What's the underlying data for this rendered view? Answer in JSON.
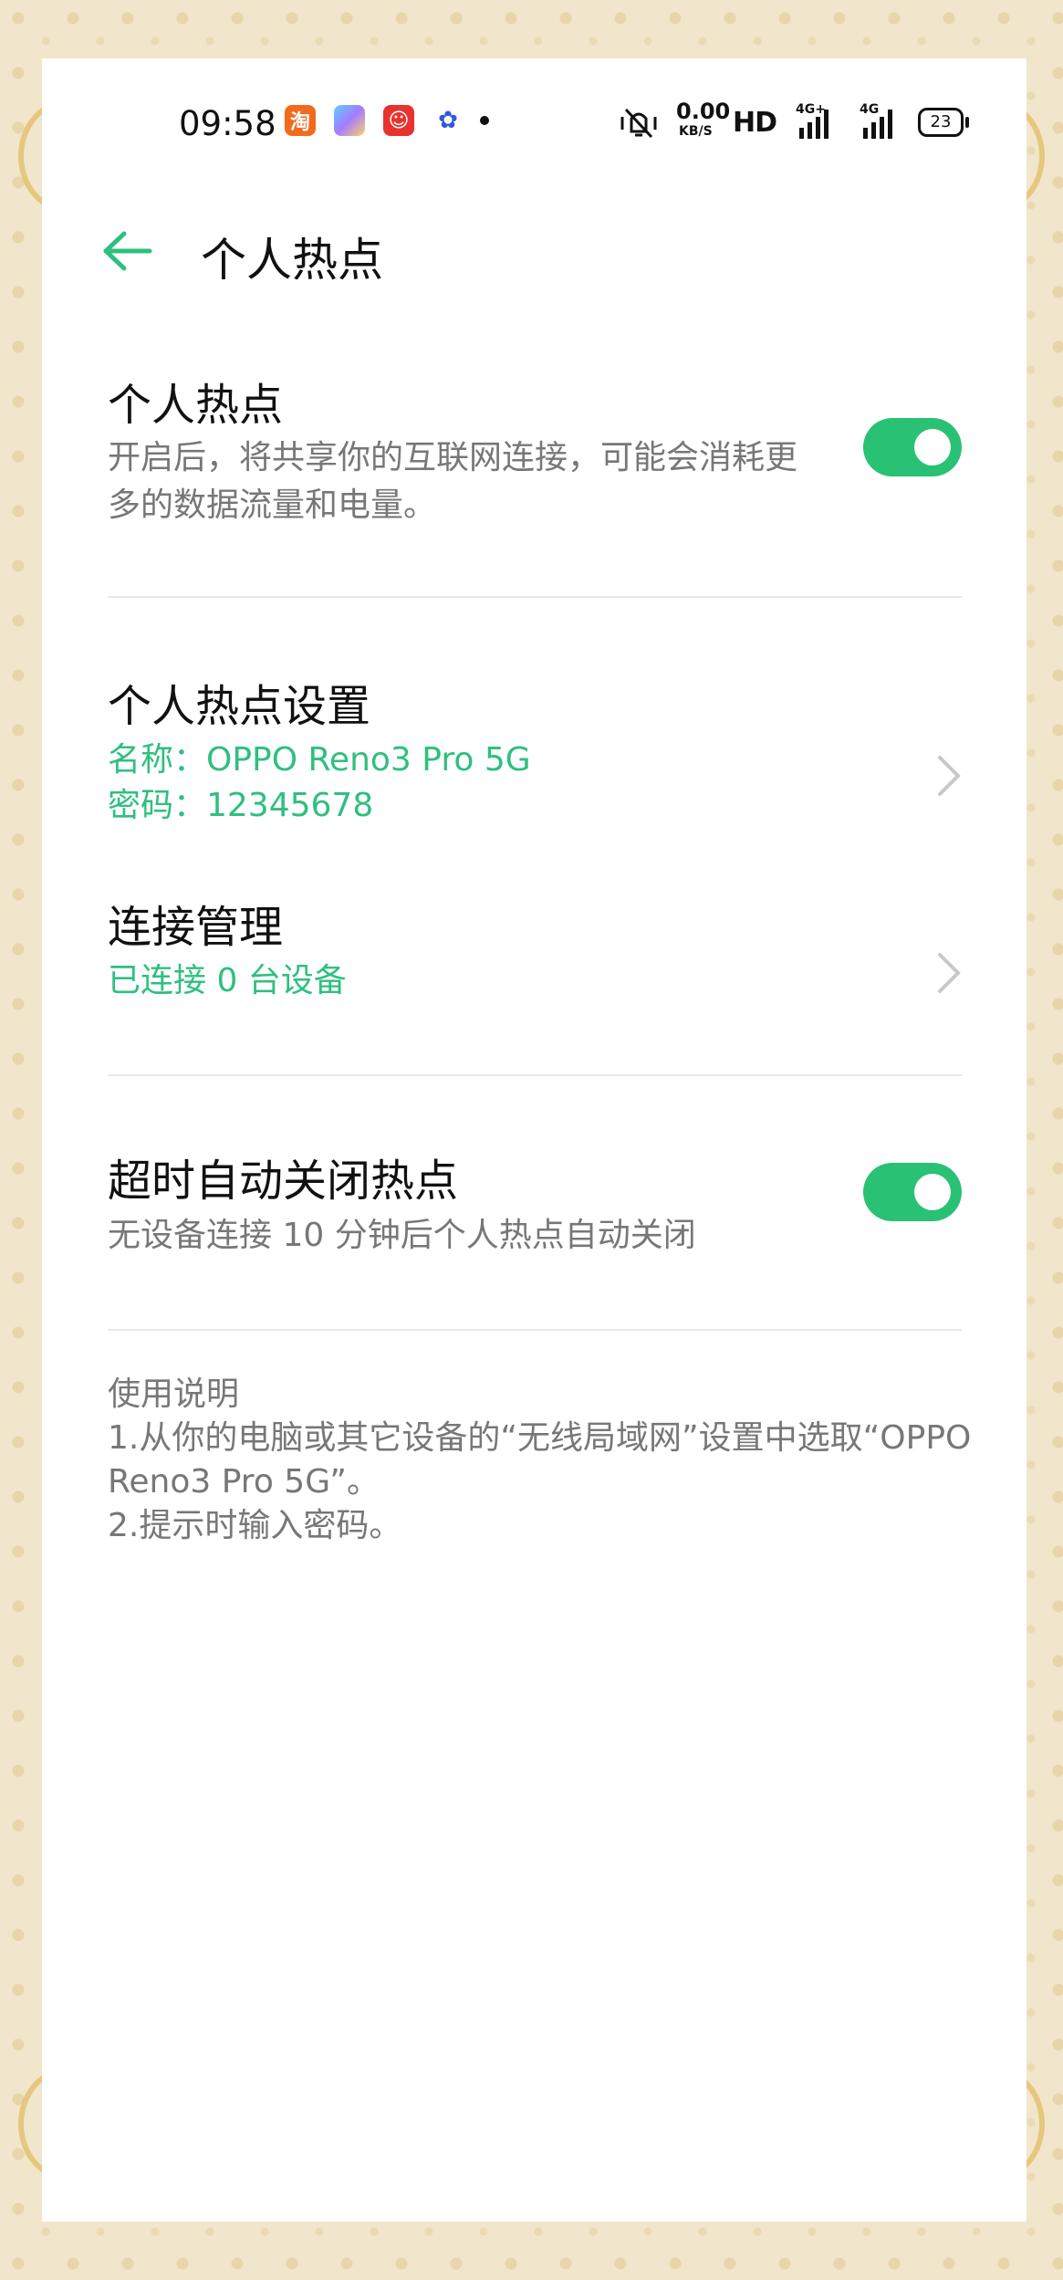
{
  "status_bar": {
    "time": "09:58",
    "speed_value": "0.00",
    "speed_unit": "KB/S",
    "hd_label": "HD",
    "sig1_label": "4G+",
    "sig2_label": "4G",
    "battery": "23",
    "app_icons": [
      "taobao-icon",
      "gallery-icon",
      "pinduoduo-icon",
      "baidu-icon"
    ]
  },
  "header": {
    "title": "个人热点"
  },
  "hotspot": {
    "title": "个人热点",
    "description_line1": "开启后，将共享你的互联网连接，可能会消耗更",
    "description_line2": "多的数据流量和电量。",
    "enabled": true
  },
  "hotspot_settings": {
    "title": "个人热点设置",
    "name_line": "名称：OPPO Reno3 Pro 5G",
    "password_line": "密码：12345678"
  },
  "connection_management": {
    "title": "连接管理",
    "status": "已连接 0 台设备"
  },
  "auto_off": {
    "title": "超时自动关闭热点",
    "description": "无设备连接 10 分钟后个人热点自动关闭",
    "enabled": true
  },
  "instructions": {
    "heading": "使用说明",
    "line1": "1.从你的电脑或其它设备的“无线局域网”设置中选取“OPPO",
    "line2": "Reno3 Pro 5G”。",
    "line3": "2.提示时输入密码。"
  },
  "colors": {
    "accent": "#29c173",
    "accent_text": "#2fbf80"
  }
}
